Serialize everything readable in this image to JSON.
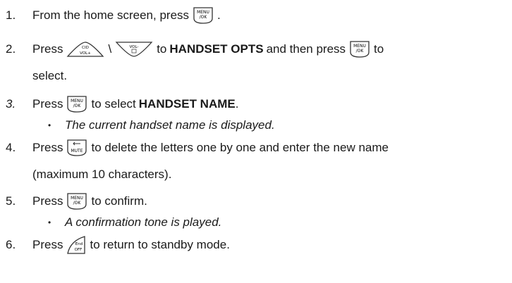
{
  "steps": [
    {
      "num": "1.",
      "pre": "From the home screen, press",
      "post": "."
    },
    {
      "num": "2.",
      "pre": "Press",
      "sep": "\\",
      "mid": "to",
      "bold": "HANDSET OPTS",
      "post": "and then press",
      "post2": "to",
      "cont": "select."
    },
    {
      "num": "3.",
      "pre": "Press",
      "mid": "to select",
      "bold": "HANDSET NAME",
      "post": ".",
      "note": "The current handset name is displayed."
    },
    {
      "num": "4.",
      "pre": "Press",
      "post": "to delete the letters one by one and enter the new name",
      "cont": "(maximum 10 characters)."
    },
    {
      "num": "5.",
      "pre": "Press",
      "post": "to confirm.",
      "note": "A confirmation tone is played."
    },
    {
      "num": "6.",
      "pre": "Press",
      "post": "to return to standby mode."
    }
  ],
  "keys": {
    "menu_top": "MENU",
    "menu_bottom": "/OK",
    "up_top": "CID",
    "up_bottom": "VOL+",
    "down_top": "VOL-",
    "mute": "MUTE",
    "end_top": "End",
    "end_bottom": "OFF"
  },
  "bullet_char": "•"
}
